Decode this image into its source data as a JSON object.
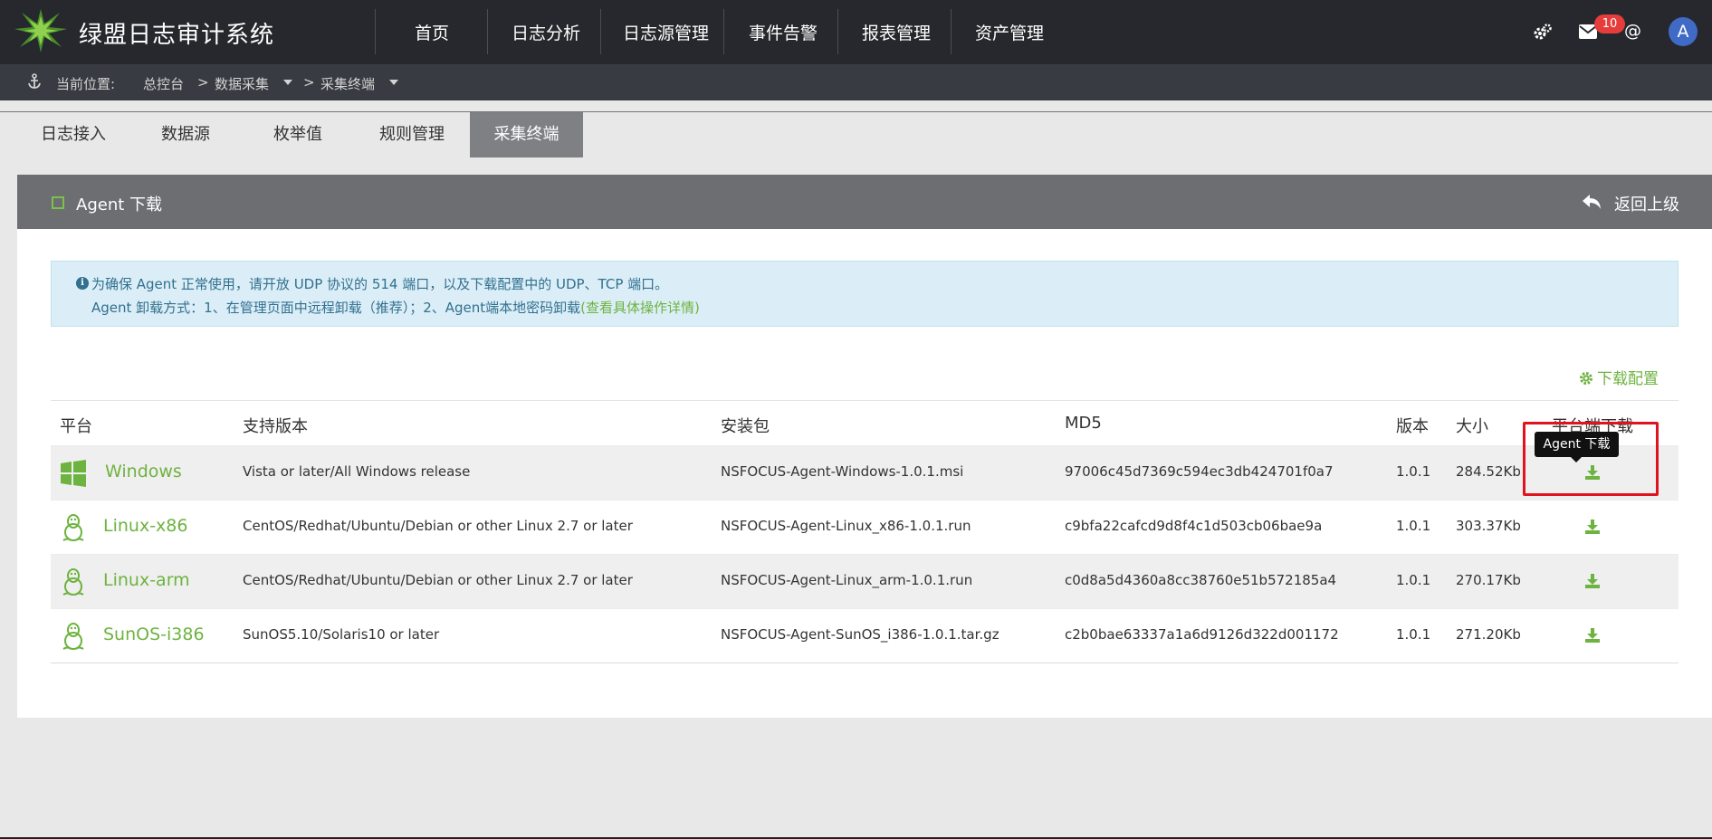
{
  "header": {
    "title": "绿盟日志审计系统",
    "nav": [
      "首页",
      "日志分析",
      "日志源管理",
      "事件告警",
      "报表管理",
      "资产管理"
    ],
    "icons": [
      "logo-icon",
      "settings-icon",
      "mail-icon",
      "at-icon"
    ],
    "mail_badge": "10",
    "at_symbol": "@",
    "avatar_letter": "A"
  },
  "breadcrumb": {
    "label": "当前位置:",
    "items": [
      "总控台",
      "数据采集",
      "采集终端"
    ],
    "separator": ">"
  },
  "tabs": [
    "日志接入",
    "数据源",
    "枚举值",
    "规则管理",
    "采集终端"
  ],
  "active_tab": "采集终端",
  "panel": {
    "title": "Agent 下载",
    "back_label": "返回上级"
  },
  "alert": {
    "line1": "为确保 Agent 正常使用，请开放 UDP 协议的 514 端口，以及下载配置中的 UDP、TCP 端口。",
    "line2": "Agent 卸载方式：1、在管理页面中远程卸载（推荐）；2、Agent端本地密码卸载",
    "link": "(查看具体操作详情)"
  },
  "download_config_label": "下载配置",
  "table": {
    "headers": [
      "平台",
      "支持版本",
      "安装包",
      "MD5",
      "版本",
      "大小",
      "平台端下载"
    ],
    "rows": [
      {
        "platform": "Windows",
        "icon": "windows-icon",
        "support": "Vista or later/All Windows release",
        "package": "NSFOCUS-Agent-Windows-1.0.1.msi",
        "md5": "97006c45d7369c594ec3db424701f0a7",
        "version": "1.0.1",
        "size": "284.52Kb"
      },
      {
        "platform": "Linux-x86",
        "icon": "linux-icon",
        "support": "CentOS/Redhat/Ubuntu/Debian or other Linux 2.7 or later",
        "package": "NSFOCUS-Agent-Linux_x86-1.0.1.run",
        "md5": "c9bfa22cafcd9d8f4c1d503cb06bae9a",
        "version": "1.0.1",
        "size": "303.37Kb"
      },
      {
        "platform": "Linux-arm",
        "icon": "linux-icon",
        "support": "CentOS/Redhat/Ubuntu/Debian or other Linux 2.7 or later",
        "package": "NSFOCUS-Agent-Linux_arm-1.0.1.run",
        "md5": "c0d8a5d4360a8cc38760e51b572185a4",
        "version": "1.0.1",
        "size": "270.17Kb"
      },
      {
        "platform": "SunOS-i386",
        "icon": "linux-icon",
        "support": "SunOS5.10/Solaris10 or later",
        "package": "NSFOCUS-Agent-SunOS_i386-1.0.1.tar.gz",
        "md5": "c2b0bae63337a1a6d9126d322d001172",
        "version": "1.0.1",
        "size": "271.20Kb"
      }
    ]
  },
  "tooltip": "Agent 下载",
  "colors": {
    "accent_green": "#6db33f",
    "header_bg": "#26282d",
    "highlight_red": "#e0141e"
  }
}
